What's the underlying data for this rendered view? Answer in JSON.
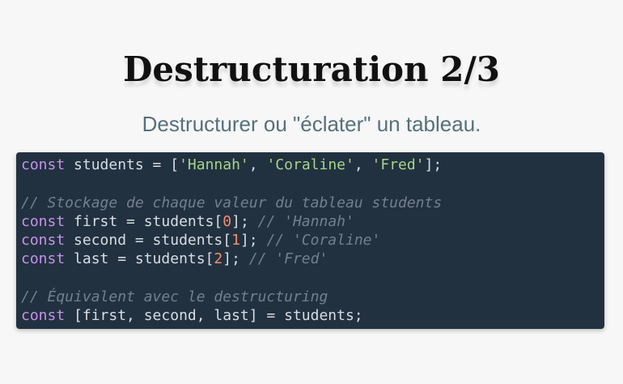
{
  "slide": {
    "title": "Destructuration 2/3",
    "subtitle": "Destructurer ou \"éclater\" un tableau."
  },
  "code": {
    "lines": [
      [
        {
          "t": "kw",
          "v": "const"
        },
        {
          "t": "pl",
          "v": " students = ["
        },
        {
          "t": "str",
          "v": "'Hannah'"
        },
        {
          "t": "pl",
          "v": ", "
        },
        {
          "t": "str",
          "v": "'Coraline'"
        },
        {
          "t": "pl",
          "v": ", "
        },
        {
          "t": "str",
          "v": "'Fred'"
        },
        {
          "t": "pl",
          "v": "];"
        }
      ],
      [],
      [
        {
          "t": "cmt",
          "v": "// Stockage de chaque valeur du tableau students"
        }
      ],
      [
        {
          "t": "kw",
          "v": "const"
        },
        {
          "t": "pl",
          "v": " first = students["
        },
        {
          "t": "num",
          "v": "0"
        },
        {
          "t": "pl",
          "v": "]; "
        },
        {
          "t": "cmt",
          "v": "// 'Hannah'"
        }
      ],
      [
        {
          "t": "kw",
          "v": "const"
        },
        {
          "t": "pl",
          "v": " second = students["
        },
        {
          "t": "num",
          "v": "1"
        },
        {
          "t": "pl",
          "v": "]; "
        },
        {
          "t": "cmt",
          "v": "// 'Coraline'"
        }
      ],
      [
        {
          "t": "kw",
          "v": "const"
        },
        {
          "t": "pl",
          "v": " last = students["
        },
        {
          "t": "num",
          "v": "2"
        },
        {
          "t": "pl",
          "v": "]; "
        },
        {
          "t": "cmt",
          "v": "// 'Fred'"
        }
      ],
      [],
      [
        {
          "t": "cmt",
          "v": "// Équivalent avec le destructuring"
        }
      ],
      [
        {
          "t": "kw",
          "v": "const"
        },
        {
          "t": "pl",
          "v": " [first, second, last] = students;"
        }
      ]
    ]
  },
  "colors": {
    "background": "#f7f7f7",
    "code_background": "#223140",
    "keyword": "#c792ea",
    "string": "#a6d58a",
    "number": "#f78c6c",
    "comment": "#73808c",
    "plain": "#d7dde3",
    "subtitle": "#56707d"
  }
}
